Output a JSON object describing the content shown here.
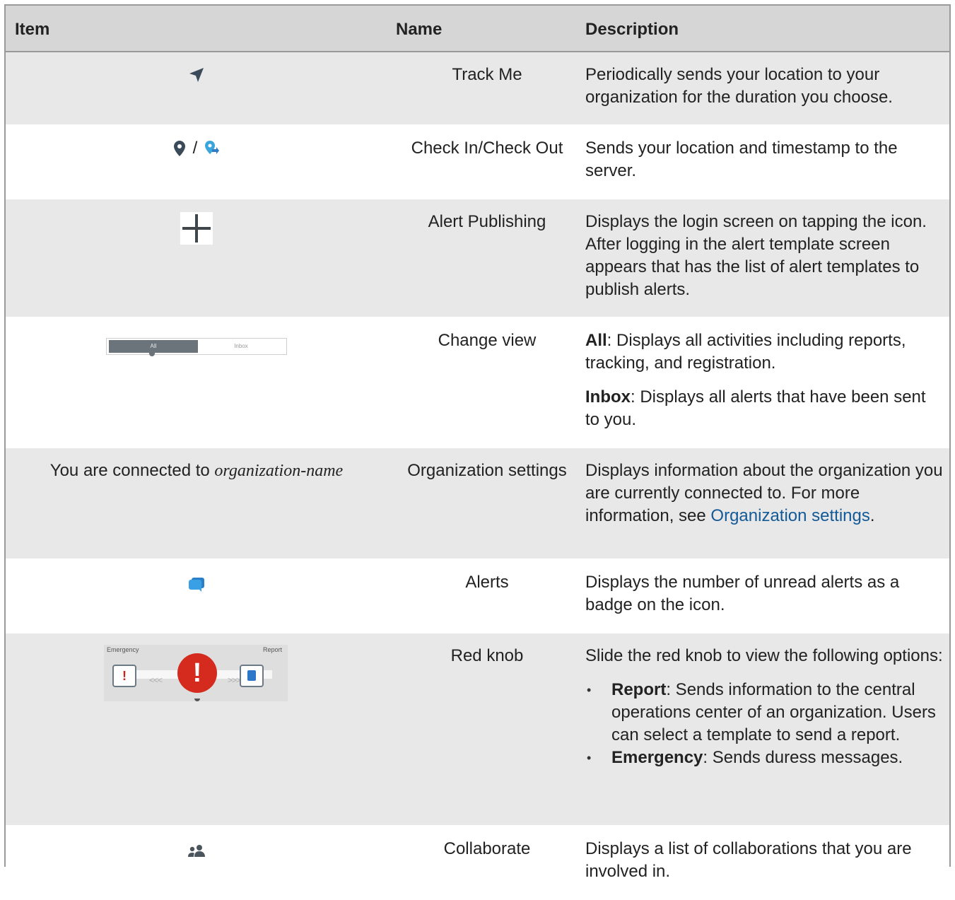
{
  "columns": [
    "Item",
    "Name",
    "Description"
  ],
  "rows": [
    {
      "icon": "navigation-arrow-icon",
      "name": "Track Me",
      "desc": "Periodically sends your location to your organization for the duration you choose."
    },
    {
      "icons": [
        "map-pin-icon",
        "map-pin-checkout-icon"
      ],
      "separator": "/",
      "name": "Check In/Check Out",
      "desc": "Sends your location and timestamp to the server."
    },
    {
      "icon": "plus-icon",
      "name": "Alert Publishing",
      "desc": "Displays the login screen on tapping the icon. After logging in the alert template screen appears that has the list of alert templates to publish alerts."
    },
    {
      "toggle": {
        "selected": "All",
        "other": "Inbox"
      },
      "name": "Change view",
      "desc_parts": [
        {
          "term": "All",
          "text": ": Displays all activities including reports, tracking, and registration."
        },
        {
          "term": "Inbox",
          "text": ": Displays all alerts that have been sent to you."
        }
      ]
    },
    {
      "item_text": "You are connected to ",
      "item_italic": "organization-name",
      "name": "Organization settings",
      "desc": "Displays information about the organization you are currently connected to. For more information, see ",
      "link": "Organization settings",
      "desc_end": "."
    },
    {
      "icon": "chat-bubbles-icon",
      "name": "Alerts",
      "desc": "Displays the number of unread alerts as a badge on the icon."
    },
    {
      "slider": {
        "left_label": "Emergency",
        "right_label": "Report",
        "left_arrows": "<<<",
        "right_arrows": ">>>",
        "knob_glyph": "!",
        "left_glyph": "!"
      },
      "name": "Red knob",
      "desc": "Slide the red knob to view the following options:",
      "bullets": [
        {
          "term": "Report",
          "text": ": Sends information to the central operations center of an organization. Users can select a template to send a report."
        },
        {
          "term": "Emergency",
          "text": ": Sends duress messages."
        }
      ]
    },
    {
      "icon": "people-icon",
      "name": "Collaborate",
      "desc": "Displays a list of collaborations that you are involved in."
    }
  ]
}
